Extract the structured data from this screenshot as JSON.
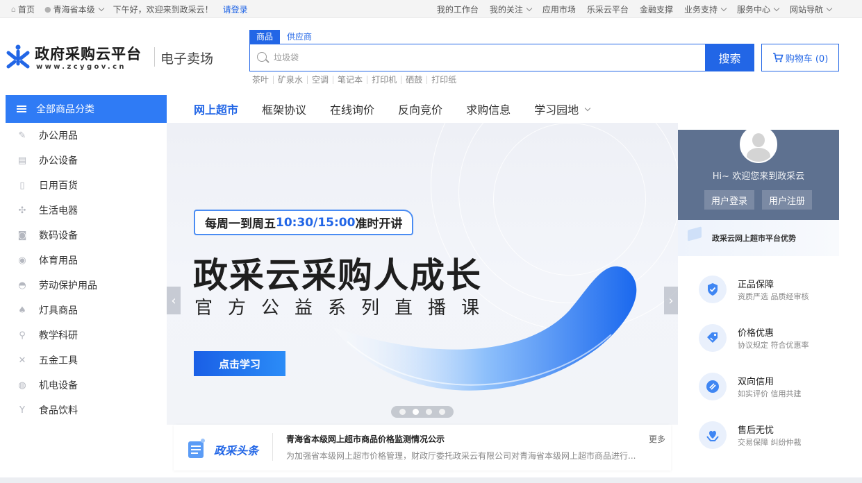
{
  "topbar": {
    "home": "首页",
    "region": "青海省本级",
    "greeting": "下午好，欢迎来到政采云！",
    "login": "请登录",
    "links": [
      {
        "label": "我的工作台",
        "caret": false
      },
      {
        "label": "我的关注",
        "caret": true
      },
      {
        "label": "应用市场",
        "caret": false
      },
      {
        "label": "乐采云平台",
        "caret": false
      },
      {
        "label": "金融支撑",
        "caret": false
      },
      {
        "label": "业务支持",
        "caret": true
      },
      {
        "label": "服务中心",
        "caret": true
      },
      {
        "label": "网站导航",
        "caret": true
      }
    ]
  },
  "header": {
    "logo_title": "政府采购云平台",
    "logo_sub": "www.zcygov.cn",
    "mall_name": "电子卖场",
    "search_tabs": [
      "商品",
      "供应商"
    ],
    "search_placeholder": "垃圾袋",
    "search_button": "搜索",
    "cart_label": "购物车 (0)",
    "hot_words": [
      "茶叶",
      "矿泉水",
      "空调",
      "笔记本",
      "打印机",
      "硒鼓",
      "打印纸"
    ]
  },
  "sidebar": {
    "title": "全部商品分类",
    "items": [
      {
        "label": "办公用品",
        "icon": "pen-icon"
      },
      {
        "label": "办公设备",
        "icon": "printer-icon"
      },
      {
        "label": "日用百货",
        "icon": "bottle-icon"
      },
      {
        "label": "生活电器",
        "icon": "fan-icon"
      },
      {
        "label": "数码设备",
        "icon": "camera-icon"
      },
      {
        "label": "体育用品",
        "icon": "ball-icon"
      },
      {
        "label": "劳动保护用品",
        "icon": "helmet-icon"
      },
      {
        "label": "灯具商品",
        "icon": "lamp-icon"
      },
      {
        "label": "教学科研",
        "icon": "microscope-icon"
      },
      {
        "label": "五金工具",
        "icon": "tools-icon"
      },
      {
        "label": "机电设备",
        "icon": "motor-icon"
      },
      {
        "label": "食品饮料",
        "icon": "cocktail-icon"
      }
    ]
  },
  "nav": {
    "items": [
      "网上超市",
      "框架协议",
      "在线询价",
      "反向竞价",
      "求购信息",
      "学习园地"
    ]
  },
  "banner": {
    "tag_prefix": "每周一到周五",
    "tag_time": "10:30/15:00",
    "tag_suffix": "准时开讲",
    "title": "政采云采购人成长",
    "subtitle": "官方公益系列直播课",
    "button": "点击学习",
    "slide_count": 4,
    "active_slide": 2
  },
  "news": {
    "brand": "政采头条",
    "title": "青海省本级网上超市商品价格监测情况公示",
    "desc": "为加强省本级网上超市价格管理，财政厅委托政采云有限公司对青海省本级网上超市商品进行...",
    "more": "更多"
  },
  "user": {
    "welcome": "Hi~ 欢迎您来到政采云",
    "login": "用户登录",
    "register": "用户注册"
  },
  "advantages": {
    "title": "政采云网上超市平台优势",
    "items": [
      {
        "title": "正品保障",
        "desc": "资质严选 品质经审核"
      },
      {
        "title": "价格优惠",
        "desc": "协议规定 符合优惠率"
      },
      {
        "title": "双向信用",
        "desc": "如实评价 信用共建"
      },
      {
        "title": "售后无忧",
        "desc": "交易保障 纠纷仲裁"
      }
    ]
  },
  "colors": {
    "accent": "#2266e6",
    "sidebar_head": "#2f7bf5",
    "user_card": "#5e7190"
  }
}
